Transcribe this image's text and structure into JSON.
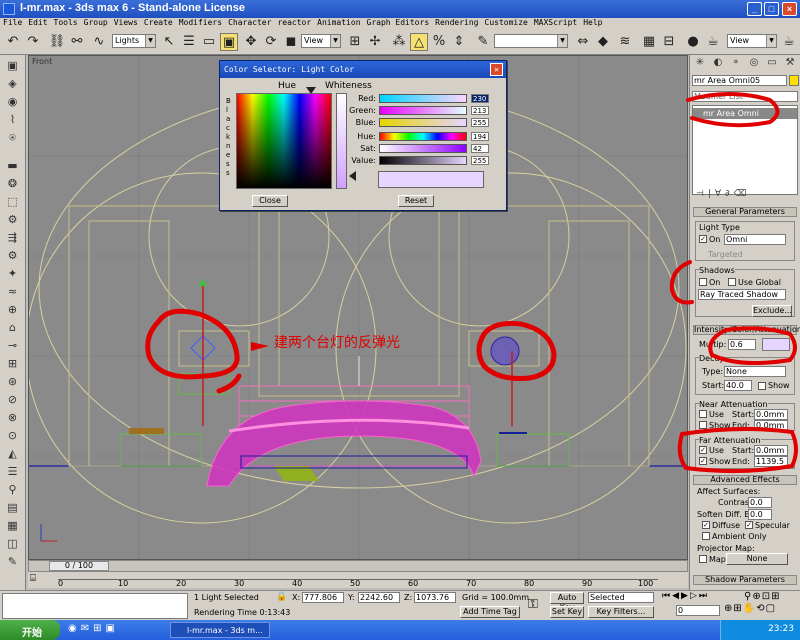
{
  "window": {
    "title": "l-mr.max - 3ds max 6 - Stand-alone License",
    "controls": [
      "_",
      "□",
      "×"
    ]
  },
  "menu": [
    "File",
    "Edit",
    "Tools",
    "Group",
    "Views",
    "Create",
    "Modifiers",
    "Character",
    "reactor",
    "Animation",
    "Graph Editors",
    "Rendering",
    "Customize",
    "MAXScript",
    "Help"
  ],
  "toolbar": {
    "selection_filter": "Lights",
    "reference_coord": "View",
    "named_selection": "",
    "render_view": "View"
  },
  "viewport": {
    "label": "Front",
    "annotation": "建两个台灯的反弹光"
  },
  "color_dialog": {
    "title": "Color Selector: Light Color",
    "hue_label": "Hue",
    "whiteness_label": "Whiteness",
    "blackness_label": "Blackness",
    "rows": [
      {
        "label": "Red:",
        "value": "230"
      },
      {
        "label": "Green:",
        "value": "213"
      },
      {
        "label": "Blue:",
        "value": "255"
      },
      {
        "label": "Hue:",
        "value": "194"
      },
      {
        "label": "Sat:",
        "value": "42"
      },
      {
        "label": "Value:",
        "value": "255"
      }
    ],
    "close_label": "Close",
    "reset_label": "Reset",
    "swatch_color": "#e6d5ff"
  },
  "command_panel": {
    "object_name": "mr Area Omni05",
    "modifier_list": "Modifier List",
    "stack_item": "mr Area Omni",
    "general_rollout": "General Parameters",
    "light_type_label": "Light Type",
    "on_label": "On",
    "light_type_value": "Omni",
    "targeted_label": "Targeted",
    "shadows_label": "Shadows",
    "shadows_on_label": "On",
    "use_global_label": "Use Global",
    "shadow_type": "Ray Traced Shadow",
    "exclude_label": "Exclude...",
    "intensity_rollout": "Intensity/Color/Attenuation",
    "multiplier_label": "Multip:",
    "multiplier_value": "0.6",
    "decay_label": "Decay",
    "decay_type_label": "Type:",
    "decay_type_value": "None",
    "decay_start_label": "Start:",
    "decay_start_value": "40.0",
    "show_label": "Show",
    "near_atten_label": "Near Attenuation",
    "use_label": "Use",
    "start_label": "Start:",
    "end_label": "End:",
    "near_start_value": "0.0mm",
    "near_end_value": "0.0mm",
    "far_atten_label": "Far Attenuation",
    "far_start_value": "0.0mm",
    "far_end_value": "1139.5",
    "advanced_rollout": "Advanced Effects",
    "affect_surfaces_label": "Affect Surfaces:",
    "contrast_label": "Contrast:",
    "contrast_value": "0.0",
    "soften_label": "Soften Diff. Edge:",
    "soften_value": "0.0",
    "diffuse_label": "Diffuse",
    "specular_label": "Specular",
    "ambient_label": "Ambient Only",
    "projector_label": "Projector Map:",
    "map_label": "Map:",
    "map_value": "None",
    "shadow_params_rollout": "Shadow Parameters"
  },
  "timeline": {
    "frame_label": "0 / 100",
    "ticks": [
      "0",
      "10",
      "20",
      "30",
      "40",
      "50",
      "60",
      "70",
      "80",
      "90",
      "100"
    ]
  },
  "status": {
    "selected": "1 Light Selected",
    "render_time": "Rendering Time  0:13:43",
    "x_label": "X:",
    "x_value": "777.806",
    "y_label": "Y:",
    "y_value": "2242.60",
    "z_label": "Z:",
    "z_value": "1073.76",
    "grid": "Grid = 100.0mm",
    "add_time_tag": "Add Time Tag",
    "auto_key": "Auto Key",
    "set_key": "Set Key",
    "key_filter_value": "Selected",
    "key_filters": "Key Filters...",
    "frame_value": "0"
  },
  "taskbar": {
    "start": "开始",
    "task": "l-mr.max - 3ds m...",
    "clock": "23:23"
  },
  "colors": {
    "annotation_red": "#e00000",
    "selection_pink": "#ff40c0",
    "ground_blue": "#1a1aa0"
  }
}
